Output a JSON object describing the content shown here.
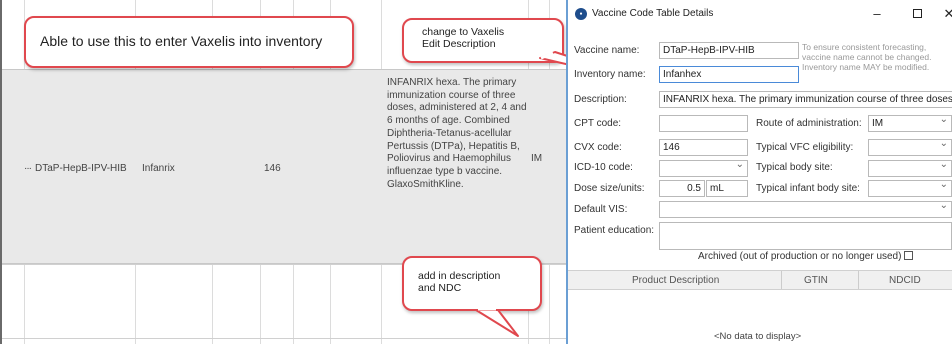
{
  "grid": {
    "row": {
      "vaccine_name": "DTaP-HepB-IPV-HIB",
      "inventory_name": "Infanrix",
      "cvx": "146",
      "route": "IM",
      "description": "INFANRIX hexa. The primary immunization course of three doses, administered at 2, 4 and 6 months of age. Combined Diphtheria-Tetanus-acellular Pertussis (DTPa), Hepatitis B, Poliovirus and Haemophilus influenzae type b vaccine. GlaxoSmithKline.",
      "row_marker": "···"
    }
  },
  "callouts": {
    "inventory": "Able to use this to enter Vaxelis into inventory",
    "edit_description": "change to Vaxelis\nEdit Description",
    "add_description": "add in description\nand NDC"
  },
  "dialog": {
    "title": "Vaccine Code Table Details",
    "controls": {
      "minimize": "–",
      "close": "✕"
    },
    "labels": {
      "vaccine_name": "Vaccine name:",
      "inventory_name": "Inventory name:",
      "description": "Description:",
      "cpt": "CPT code:",
      "cvx": "CVX code:",
      "icd10": "ICD-10 code:",
      "dose": "Dose size/units:",
      "vis": "Default VIS:",
      "education": "Patient education:",
      "route": "Route of administration:",
      "vfc": "Typical VFC eligibility:",
      "body_site": "Typical body site:",
      "infant_site": "Typical infant body site:"
    },
    "values": {
      "vaccine_name": "DTaP-HepB-IPV-HIB",
      "inventory_name": "Infanhex",
      "description": "INFANRIX hexa. The primary immunization course of three doses",
      "cpt": "",
      "cvx": "146",
      "icd10": "",
      "dose_size": "0.5",
      "dose_units": "mL",
      "vis": "",
      "education": "",
      "route": "IM",
      "vfc": "",
      "body_site": "",
      "infant_site": ""
    },
    "hint": "To ensure consistent forecasting, vaccine name cannot be changed. Inventory name MAY be modified.",
    "archived_label": "Archived (out of production or no longer used)",
    "archived_checked": false,
    "subgrid": {
      "columns": [
        "Product Description",
        "GTIN",
        "NDCID"
      ],
      "empty_text": "<No data to display>"
    }
  },
  "colors": {
    "callout_border": "#e0484e",
    "row_highlight": "#e9e9e9",
    "focus_border": "#4a8ad8",
    "app_icon": "#1e4d8c"
  },
  "icons": {
    "app": "vaccine-app-icon",
    "minimize": "minimize-icon",
    "maximize": "maximize-icon",
    "close": "close-icon",
    "dropdown": "chevron-down-icon"
  }
}
